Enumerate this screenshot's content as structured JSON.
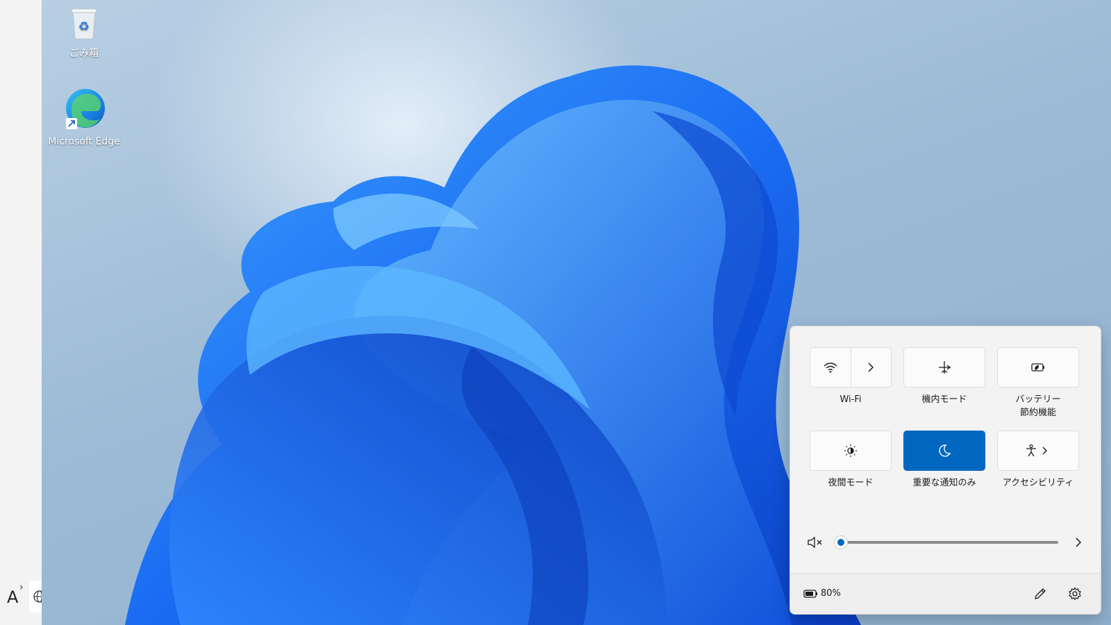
{
  "desktop": {
    "icons": [
      {
        "label": "ごみ箱",
        "icon": "recycle-bin-icon"
      },
      {
        "label": "Microsoft Edge",
        "icon": "edge-icon"
      }
    ]
  },
  "ime": {
    "mode_label": "A"
  },
  "quick_settings": {
    "tiles": [
      {
        "label": "Wi-Fi",
        "icon": "wifi-icon",
        "state": "off",
        "expandable": true
      },
      {
        "label": "機内モード",
        "icon": "airplane-icon",
        "state": "off"
      },
      {
        "label_line1": "バッテリー",
        "label_line2": "節約機能",
        "icon": "battery-saver-icon",
        "state": "off"
      },
      {
        "label": "夜間モード",
        "icon": "night-light-icon",
        "state": "off"
      },
      {
        "label": "重要な通知のみ",
        "icon": "moon-icon",
        "state": "on"
      },
      {
        "label": "アクセシビリティ",
        "icon": "accessibility-icon",
        "state": "off",
        "expandable": true
      }
    ],
    "volume": {
      "icon": "speaker-muted-icon",
      "level": 0
    },
    "footer": {
      "battery_percent": "80%",
      "icons": [
        "battery-icon",
        "pencil-icon",
        "gear-icon"
      ]
    }
  },
  "colors": {
    "accent": "#0067c0",
    "flyout_bg": "#f3f3f3"
  }
}
